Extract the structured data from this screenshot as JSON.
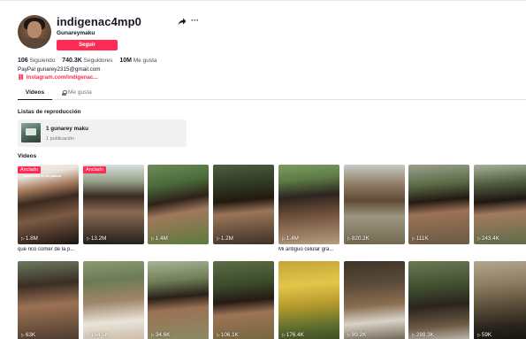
{
  "profile": {
    "username": "indigenac4mp0",
    "display_name": "Gunareymaku",
    "follow_label": "Seguir",
    "stats": {
      "following_count": "106",
      "following_label": "Siguiendo",
      "followers_count": "740.3K",
      "followers_label": "Seguidores",
      "likes_count": "10M",
      "likes_label": "Me gusta"
    },
    "bio": "PayPal gunarey2315@gmail.com",
    "link": "instagram.com/indigenac...",
    "icons": {
      "share": "share-icon",
      "more": "more-options-icon",
      "link": "link-icon"
    }
  },
  "tabs": [
    {
      "label": "Videos",
      "active": true
    },
    {
      "label": "Me gusta",
      "active": false,
      "icon": "lock-icon"
    }
  ],
  "playlists": {
    "title": "Listas de reproducción",
    "items": [
      {
        "name": "1 gunarey maku",
        "count": "1 publicación"
      }
    ]
  },
  "videos": {
    "title": "Videos",
    "pinned_label": "Anclado",
    "items": [
      {
        "views": "1.8M",
        "pinned": true,
        "caption": "que rico comer de la p...",
        "overlay": "comiendo en mi paseo"
      },
      {
        "views": "13.2M",
        "pinned": true,
        "caption": ""
      },
      {
        "views": "1.4M",
        "caption": ""
      },
      {
        "views": "1.2M",
        "caption": ""
      },
      {
        "views": "1.4M",
        "caption": "Mi antiguo celular gra..."
      },
      {
        "views": "820.2K",
        "caption": ""
      },
      {
        "views": "111K",
        "caption": ""
      },
      {
        "views": "243.4K",
        "caption": ""
      },
      {
        "views": "63K",
        "caption": ""
      },
      {
        "views": "164.5K",
        "caption": ""
      },
      {
        "views": "34.6K",
        "caption": ""
      },
      {
        "views": "106.1K",
        "caption": ""
      },
      {
        "views": "176.4K",
        "caption": ""
      },
      {
        "views": "99.2K",
        "caption": ""
      },
      {
        "views": "288.3K",
        "caption": ""
      },
      {
        "views": "59K",
        "caption": ""
      }
    ]
  },
  "colors": {
    "accent": "#fe2c55",
    "text": "#161823",
    "muted": "#73757b",
    "card_bg": "#f1f1f2"
  }
}
